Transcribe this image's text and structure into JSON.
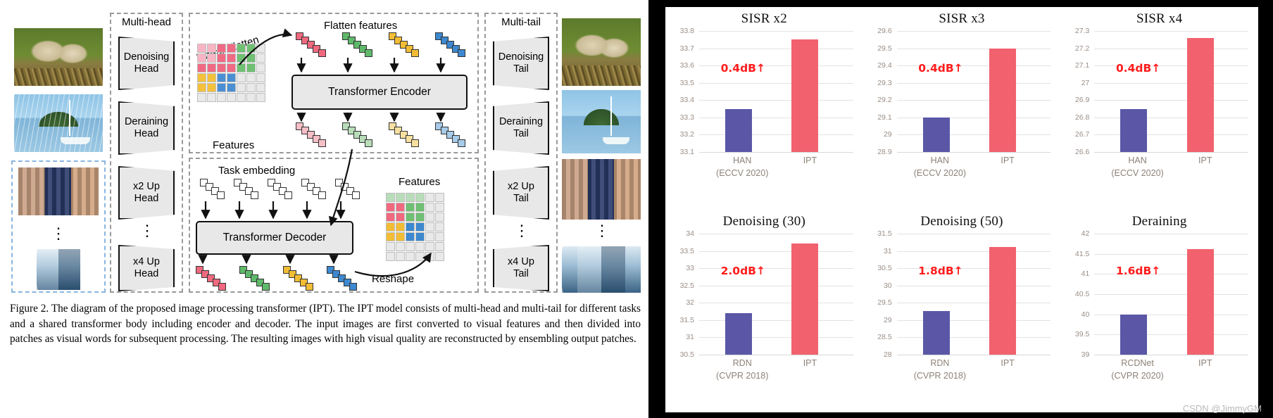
{
  "figure": {
    "caption": "Figure 2. The diagram of the proposed image processing transformer (IPT). The IPT model consists of multi-head and multi-tail for different tasks and a shared transformer body including encoder and decoder. The input images are first converted to visual features and then divided into patches as visual words for subsequent processing. The resulting images with high visual quality are reconstructed by ensembling output patches.",
    "labels": {
      "multi_head": "Multi-head",
      "multi_tail": "Multi-tail",
      "linear_flatten": "Linear Flatten",
      "flatten_features": "Flatten features",
      "features": "Features",
      "features2": "Features",
      "task_embedding": "Task embedding",
      "transformer_encoder": "Transformer Encoder",
      "transformer_decoder": "Transformer Decoder",
      "reshape": "Reshape",
      "ellipsis": "⋮"
    },
    "heads": [
      {
        "line1": "Denoising",
        "line2": "Head"
      },
      {
        "line1": "Deraining",
        "line2": "Head"
      },
      {
        "line1": "x2 Up",
        "line2": "Head"
      },
      {
        "line1": "x4 Up",
        "line2": "Head"
      }
    ],
    "tails": [
      {
        "line1": "Denoising",
        "line2": "Tail"
      },
      {
        "line1": "Deraining",
        "line2": "Tail"
      },
      {
        "line1": "x2 Up",
        "line2": "Tail"
      },
      {
        "line1": "x4 Up",
        "line2": "Tail"
      }
    ],
    "thumbnails_left": [
      "bird-noisy-image",
      "boat-rainy-image",
      "face-lowres-image",
      "tower-lowres-image"
    ],
    "thumbnails_right": [
      "bird-denoised-image",
      "boat-derained-image",
      "face-upscaled-image",
      "tower-upscaled-image"
    ]
  },
  "watermark": "CSDN @JimmyGM",
  "colors": {
    "bar_baseline": "#5b57a6",
    "bar_ipt": "#f1626e",
    "delta_text": "#ff1d1d",
    "gridline": "#e3e3e3",
    "tick_text": "#9a8e86",
    "xlabel_text": "#8d8278"
  },
  "chart_data": [
    {
      "type": "bar",
      "title": "SISR x2",
      "categories": [
        "HAN",
        "IPT"
      ],
      "category_subtitles": [
        "(ECCV 2020)",
        ""
      ],
      "values": [
        33.35,
        33.75
      ],
      "ylim": [
        33.1,
        33.8
      ],
      "yticks": [
        33.8,
        33.7,
        33.6,
        33.5,
        33.4,
        33.3,
        33.2,
        33.1
      ],
      "ytick_labels": [
        "33.8",
        "33.7",
        "33.6",
        "33.5",
        "33.4",
        "33.3",
        "33.2",
        "33.1"
      ],
      "annotation": "0.4dB↑",
      "xlabel": "",
      "ylabel": "",
      "grid": true,
      "legend": "none"
    },
    {
      "type": "bar",
      "title": "SISR x3",
      "categories": [
        "HAN",
        "IPT"
      ],
      "category_subtitles": [
        "(ECCV 2020)",
        ""
      ],
      "values": [
        29.1,
        29.5
      ],
      "ylim": [
        28.9,
        29.6
      ],
      "yticks": [
        29.6,
        29.5,
        29.4,
        29.3,
        29.2,
        29.1,
        29.0,
        28.9
      ],
      "ytick_labels": [
        "29.6",
        "29.5",
        "29.4",
        "29.3",
        "29.2",
        "29.1",
        "29",
        "28.9"
      ],
      "annotation": "0.4dB↑",
      "xlabel": "",
      "ylabel": "",
      "grid": true,
      "legend": "none"
    },
    {
      "type": "bar",
      "title": "SISR x4",
      "categories": [
        "HAN",
        "IPT"
      ],
      "category_subtitles": [
        "(ECCV 2020)",
        ""
      ],
      "values": [
        26.85,
        27.26
      ],
      "ylim": [
        26.6,
        27.3
      ],
      "yticks": [
        27.3,
        27.2,
        27.1,
        27.0,
        26.9,
        26.8,
        26.7,
        26.6
      ],
      "ytick_labels": [
        "27.3",
        "27.2",
        "27.1",
        "27",
        "26.9",
        "26.8",
        "26.7",
        "26.6"
      ],
      "annotation": "0.4dB↑",
      "xlabel": "",
      "ylabel": "",
      "grid": true,
      "legend": "none"
    },
    {
      "type": "bar",
      "title": "Denoising (30)",
      "categories": [
        "RDN",
        "IPT"
      ],
      "category_subtitles": [
        "(CVPR 2018)",
        ""
      ],
      "values": [
        31.7,
        33.72
      ],
      "ylim": [
        30.5,
        34.0
      ],
      "yticks": [
        34.0,
        33.5,
        33.0,
        32.5,
        32.0,
        31.5,
        31.0,
        30.5
      ],
      "ytick_labels": [
        "34",
        "33.5",
        "33",
        "32.5",
        "32",
        "31.5",
        "31",
        "30.5"
      ],
      "annotation": "2.0dB↑",
      "xlabel": "",
      "ylabel": "",
      "grid": true,
      "legend": "none"
    },
    {
      "type": "bar",
      "title": "Denoising (50)",
      "categories": [
        "RDN",
        "IPT"
      ],
      "category_subtitles": [
        "(CVPR 2018)",
        ""
      ],
      "values": [
        29.27,
        31.12
      ],
      "ylim": [
        28.0,
        31.5
      ],
      "yticks": [
        31.5,
        31.0,
        30.5,
        30.0,
        29.5,
        29.0,
        28.5,
        28.0
      ],
      "ytick_labels": [
        "31.5",
        "31",
        "30.5",
        "30",
        "29.5",
        "29",
        "28.5",
        "28"
      ],
      "annotation": "1.8dB↑",
      "xlabel": "",
      "ylabel": "",
      "grid": true,
      "legend": "none"
    },
    {
      "type": "bar",
      "title": "Deraining",
      "categories": [
        "RCDNet",
        "IPT"
      ],
      "category_subtitles": [
        "(CVPR 2020)",
        ""
      ],
      "values": [
        40.0,
        41.62
      ],
      "ylim": [
        39.0,
        42.0
      ],
      "yticks": [
        42.0,
        41.5,
        41.0,
        40.5,
        40.0,
        39.5,
        39.0
      ],
      "ytick_labels": [
        "42",
        "41.5",
        "41",
        "40.5",
        "40",
        "39.5",
        "39"
      ],
      "annotation": "1.6dB↑",
      "xlabel": "",
      "ylabel": "",
      "grid": true,
      "legend": "none"
    }
  ]
}
